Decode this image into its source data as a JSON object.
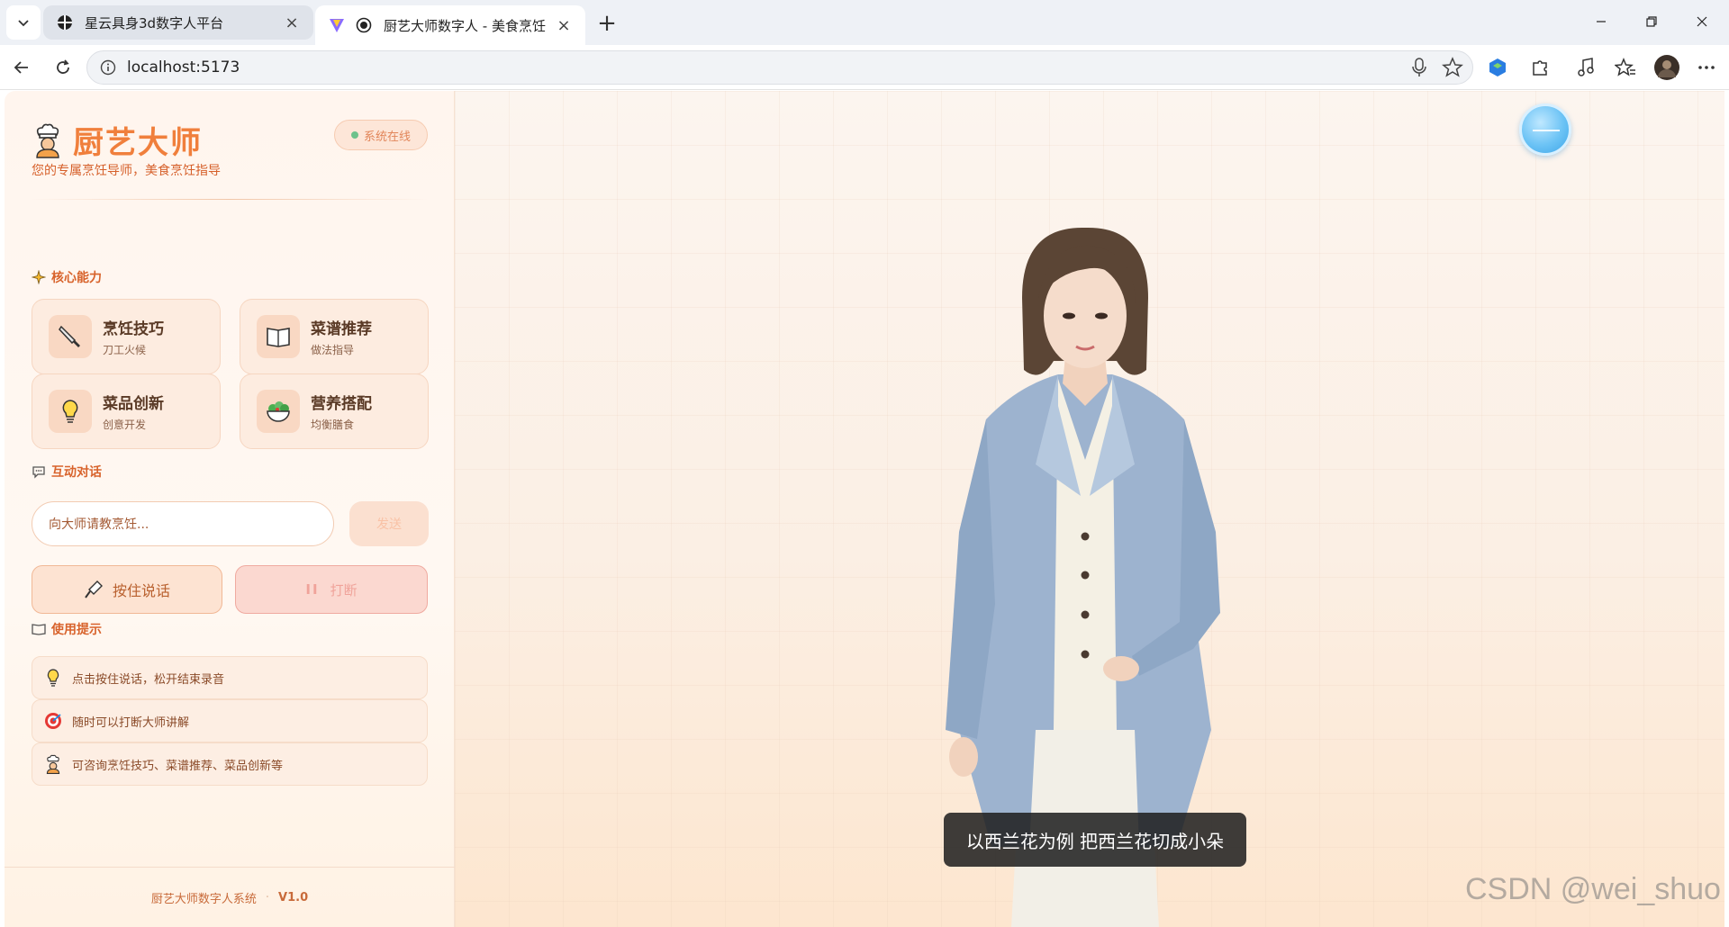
{
  "browser": {
    "tabs": [
      {
        "title": "星云具身3d数字人平台",
        "active": false
      },
      {
        "title": "厨艺大师数字人 - 美食烹饪",
        "active": true
      }
    ],
    "url": "localhost:5173"
  },
  "sidebar": {
    "brand": "厨艺大师",
    "tagline": "您的专属烹饪导师，美食烹饪指导",
    "status": "系统在线",
    "capabilities_title": "核心能力",
    "capabilities": [
      {
        "title": "烹饪技巧",
        "subtitle": "刀工火候",
        "icon": "knife-icon"
      },
      {
        "title": "菜谱推荐",
        "subtitle": "做法指导",
        "icon": "book-icon"
      },
      {
        "title": "菜品创新",
        "subtitle": "创意开发",
        "icon": "lightbulb-icon"
      },
      {
        "title": "营养搭配",
        "subtitle": "均衡膳食",
        "icon": "salad-icon"
      }
    ],
    "chat_title": "互动对话",
    "input_placeholder": "向大师请教烹饪...",
    "send_label": "发送",
    "talk_label": "按住说话",
    "interrupt_label": "打断",
    "tips_title": "使用提示",
    "tips": [
      {
        "text": "点击按住说话，松开结束录音",
        "icon": "lightbulb-icon"
      },
      {
        "text": "随时可以打断大师讲解",
        "icon": "target-icon"
      },
      {
        "text": "可咨询烹饪技巧、菜谱推荐、菜品创新等",
        "icon": "chef-icon"
      }
    ],
    "footer_name": "厨艺大师数字人系统",
    "footer_sep": "·",
    "footer_version": "V1.0"
  },
  "stage": {
    "subtitle": "以西兰花为例 把西兰花切成小朵",
    "watermark": "CSDN @wei_shuo"
  },
  "colors": {
    "accent": "#f07f3c",
    "status_dot": "#6cc28c"
  }
}
